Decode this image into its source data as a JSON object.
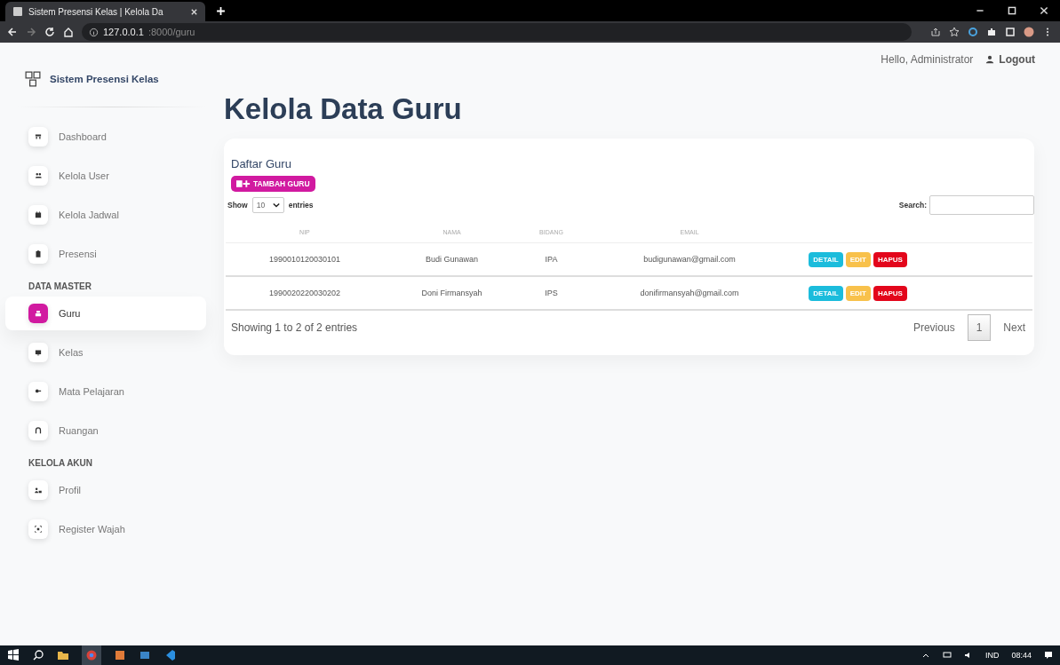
{
  "browser": {
    "tab_title": "Sistem Presensi Kelas | Kelola Da",
    "url_host": "127.0.0.1",
    "url_rest": ":8000/guru"
  },
  "header": {
    "greeting": "Hello, Administrator",
    "logout": "Logout"
  },
  "sidebar": {
    "brand": "Sistem Presensi Kelas",
    "groups": [
      {
        "items": [
          {
            "label": "Dashboard",
            "selected": false
          },
          {
            "label": "Kelola User",
            "selected": false
          },
          {
            "label": "Kelola Jadwal",
            "selected": false
          },
          {
            "label": "Presensi",
            "selected": false
          }
        ]
      },
      {
        "heading": "DATA MASTER",
        "items": [
          {
            "label": "Guru",
            "selected": true
          },
          {
            "label": "Kelas",
            "selected": false
          },
          {
            "label": "Mata Pelajaran",
            "selected": false
          },
          {
            "label": "Ruangan",
            "selected": false
          }
        ]
      },
      {
        "heading": "KELOLA AKUN",
        "items": [
          {
            "label": "Profil",
            "selected": false
          },
          {
            "label": "Register Wajah",
            "selected": false
          }
        ]
      }
    ]
  },
  "page_title": "Kelola Data Guru",
  "card": {
    "heading": "Daftar Guru",
    "add_button": "TAMBAH GURU",
    "length": {
      "show": "Show",
      "value": "10",
      "entries": "entries"
    },
    "search_label": "Search:",
    "columns": [
      "NIP",
      "NAMA",
      "BIDANG",
      "EMAIL"
    ],
    "rows": [
      {
        "cells": [
          "1990010120030101",
          "Budi Gunawan",
          "IPA",
          "budigunawan@gmail.com"
        ],
        "actions": [
          {
            "kind": "info",
            "label": "DETAIL"
          },
          {
            "kind": "warning",
            "label": "EDIT"
          },
          {
            "kind": "danger",
            "label": "HAPUS"
          }
        ]
      },
      {
        "cells": [
          "1990020220030202",
          "Doni Firmansyah",
          "IPS",
          "donifirmansyah@gmail.com"
        ],
        "actions": [
          {
            "kind": "info",
            "label": "DETAIL"
          },
          {
            "kind": "warning",
            "label": "EDIT"
          },
          {
            "kind": "danger",
            "label": "HAPUS"
          }
        ]
      }
    ],
    "info": "Showing 1 to 2 of 2 entries",
    "pagination": {
      "previous": "Previous",
      "pages": [
        {
          "label": "1",
          "selected": true
        }
      ],
      "next": "Next"
    }
  },
  "taskbar": {
    "language": "IND",
    "time": "08:44"
  }
}
